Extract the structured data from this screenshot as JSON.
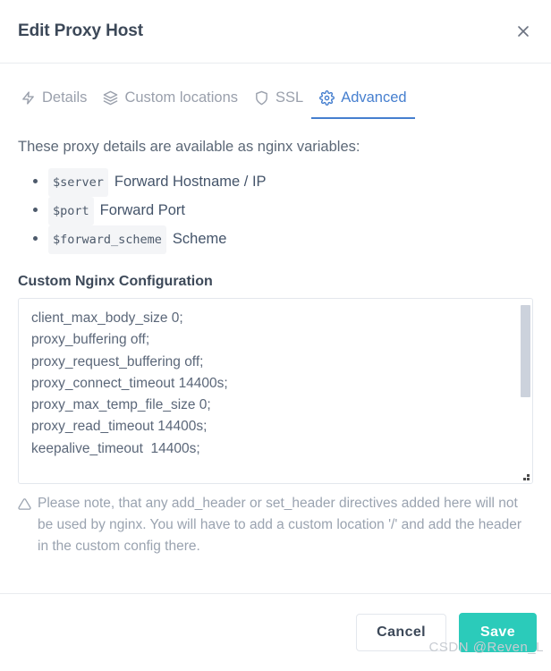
{
  "header": {
    "title": "Edit Proxy Host",
    "close_icon": "close-icon"
  },
  "tabs": [
    {
      "id": "details",
      "label": "Details",
      "icon": "lightning-bolt-icon",
      "active": false
    },
    {
      "id": "custom-locations",
      "label": "Custom locations",
      "icon": "layers-icon",
      "active": false
    },
    {
      "id": "ssl",
      "label": "SSL",
      "icon": "shield-icon",
      "active": false
    },
    {
      "id": "advanced",
      "label": "Advanced",
      "icon": "gear-icon",
      "active": true
    }
  ],
  "body": {
    "intro": "These proxy details are available as nginx variables:",
    "variables": [
      {
        "code": "$server",
        "description": "Forward Hostname / IP"
      },
      {
        "code": "$port",
        "description": "Forward Port"
      },
      {
        "code": "$forward_scheme",
        "description": "Scheme"
      }
    ],
    "config_label": "Custom Nginx Configuration",
    "config_lines": [
      "client_max_body_size 0;",
      "proxy_buffering off;",
      "proxy_request_buffering off;",
      "proxy_connect_timeout 14400s;",
      "proxy_max_temp_file_size 0;",
      "proxy_read_timeout 14400s;",
      "keepalive_timeout  14400s;"
    ],
    "warning_icon": "warning-triangle-icon",
    "warning_text": "Please note, that any add_header or set_header directives added here will not be used by nginx. You will have to add a custom location '/' and add the header in the custom config there."
  },
  "footer": {
    "cancel_label": "Cancel",
    "save_label": "Save"
  },
  "watermark": "CSDN @Reven_L",
  "colors": {
    "accent_blue": "#467fcf",
    "save_teal": "#2bcbba",
    "text_dark": "#3c4858",
    "text_muted": "#9aa0ac",
    "border": "#e9ecef"
  }
}
